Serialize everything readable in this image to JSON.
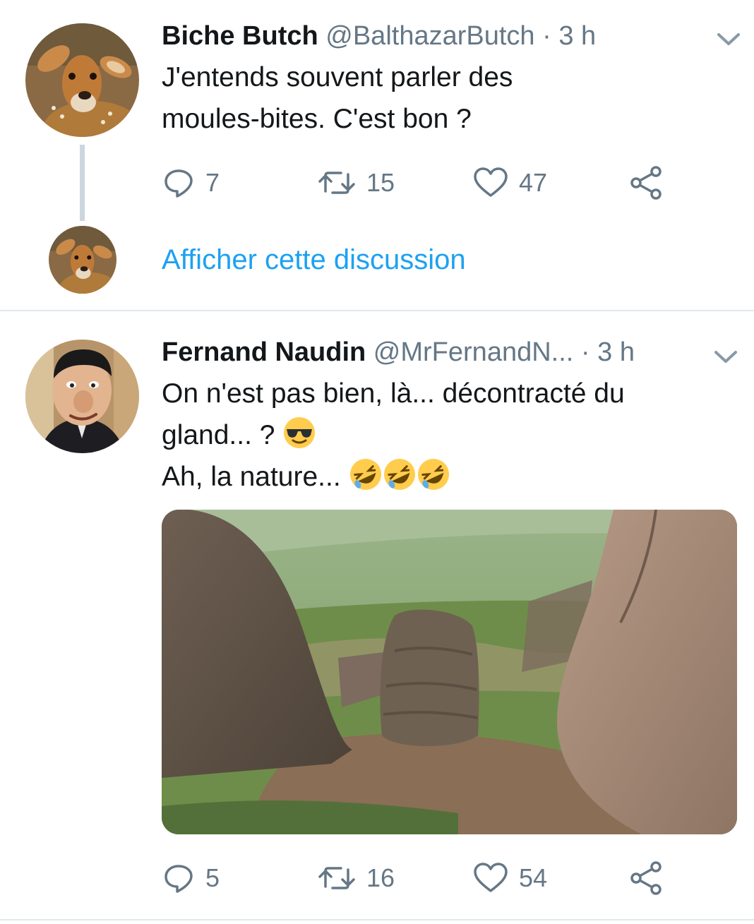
{
  "tweet1": {
    "author_name": "Biche Butch",
    "handle": "@BalthazarButch",
    "separator": "·",
    "time": "3 h",
    "text_line1": "J'entends souvent parler des",
    "text_line2": "moules-bites. C'est bon ?",
    "replies": "7",
    "retweets": "15",
    "likes": "47"
  },
  "thread": {
    "show_thread_label": "Afficher cette discussion"
  },
  "tweet2": {
    "author_name": "Fernand Naudin",
    "handle": "@MrFernandN...",
    "separator": "·",
    "time": "3 h",
    "text_line1": "On n'est pas bien, là... décontracté du",
    "text_line2": "gland... ?",
    "text_line3": "Ah, la nature...",
    "replies": "5",
    "retweets": "16",
    "likes": "54"
  },
  "icons": {
    "reply": "reply-icon",
    "retweet": "retweet-icon",
    "like": "like-icon",
    "share": "share-icon",
    "menu": "chevron-down-icon"
  },
  "colors": {
    "link": "#1da1f2",
    "secondary_text": "#657786",
    "divider": "#e1e8ed"
  }
}
